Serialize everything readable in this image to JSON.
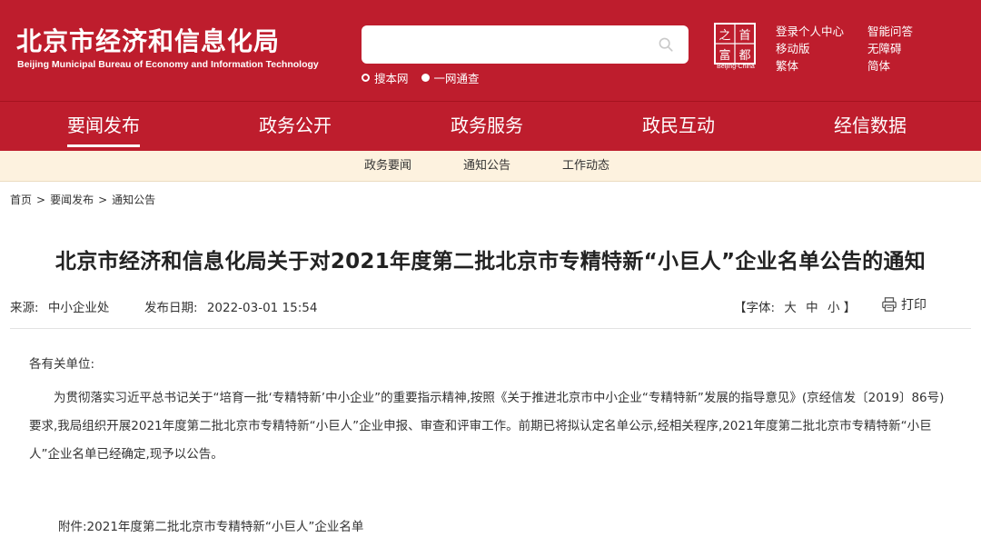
{
  "header": {
    "title": "北京市经济和信息化局",
    "title_en": "Beijing Municipal Bureau of Economy and Information Technology",
    "search": {
      "placeholder": "",
      "value": ""
    },
    "search_options": [
      "搜本网",
      "一网通查"
    ],
    "seal_caption": "Beijing-China",
    "utility_links": [
      "登录个人中心",
      "移动版",
      "繁体",
      "智能问答",
      "无障碍",
      "简体"
    ]
  },
  "main_nav": [
    "要闻发布",
    "政务公开",
    "政务服务",
    "政民互动",
    "经信数据"
  ],
  "sub_nav": [
    "政务要闻",
    "通知公告",
    "工作动态"
  ],
  "breadcrumb": [
    "首页",
    "要闻发布",
    "通知公告"
  ],
  "breadcrumb_sep": ">",
  "article": {
    "title": "北京市经济和信息化局关于对2021年度第二批北京市专精特新“小巨人”企业名单公告的通知",
    "source_label": "来源:",
    "source": "中小企业处",
    "date_label": "发布日期:",
    "date": "2022-03-01 15:54",
    "font_label": "【字体:",
    "font_sizes": [
      "大",
      "中",
      "小"
    ],
    "font_close": "】",
    "print_label": "打印",
    "salutation": "各有关单位:",
    "paragraph": "为贯彻落实习近平总书记关于“培育一批‘专精特新’中小企业”的重要指示精神,按照《关于推进北京市中小企业“专精特新”发展的指导意见》(京经信发〔2019〕86号)要求,我局组织开展2021年度第二批北京市专精特新“小巨人”企业申报、审查和评审工作。前期已将拟认定名单公示,经相关程序,2021年度第二批北京市专精特新“小巨人”企业名单已经确定,现予以公告。",
    "attachment": "附件:2021年度第二批北京市专精特新“小巨人”企业名单"
  },
  "colors": {
    "brand_red": "#be1d2d",
    "subnav_bg": "#fdf2df",
    "text": "#333333"
  },
  "icons": [
    "search-icon",
    "print-icon",
    "capital-seal-logo"
  ]
}
